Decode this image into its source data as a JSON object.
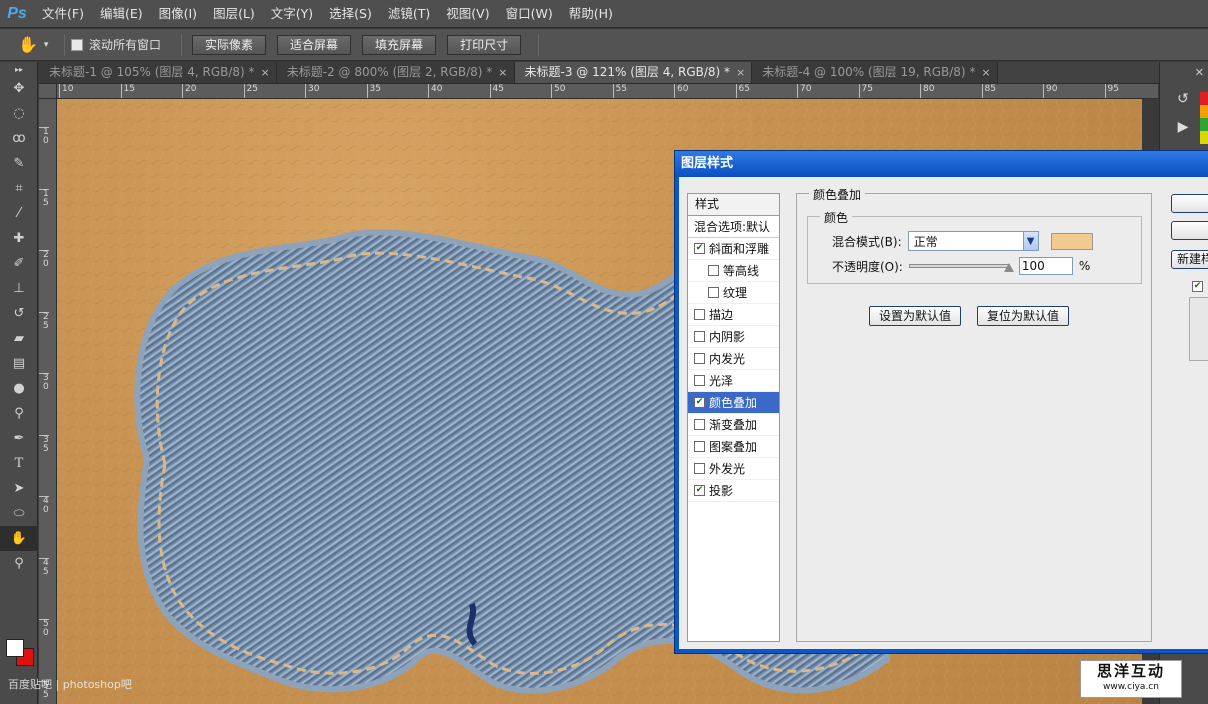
{
  "app": {
    "logo": "Ps"
  },
  "menu": [
    "文件(F)",
    "编辑(E)",
    "图像(I)",
    "图层(L)",
    "文字(Y)",
    "选择(S)",
    "滤镜(T)",
    "视图(V)",
    "窗口(W)",
    "帮助(H)"
  ],
  "options": {
    "scroll_all_label": "滚动所有窗口",
    "buttons": [
      "实际像素",
      "适合屏幕",
      "填充屏幕",
      "打印尺寸"
    ]
  },
  "tabs": [
    {
      "label": "未标题-1 @ 105% (图层 4, RGB/8) *",
      "active": false
    },
    {
      "label": "未标题-2 @ 800% (图层 2, RGB/8) *",
      "active": false
    },
    {
      "label": "未标题-3 @ 121% (图层 4, RGB/8) *",
      "active": true
    },
    {
      "label": "未标题-4 @ 100% (图层 19, RGB/8) *",
      "active": false
    }
  ],
  "ruler_h": [
    "10",
    "15",
    "20",
    "25",
    "30",
    "35",
    "40",
    "45",
    "50",
    "55",
    "60",
    "65",
    "70",
    "75",
    "80",
    "85",
    "90",
    "95"
  ],
  "ruler_v": [
    "10",
    "15",
    "20",
    "25",
    "30",
    "35",
    "40",
    "45",
    "50",
    "55"
  ],
  "dialog": {
    "title": "图层样式",
    "styles_header": "样式",
    "blend_options": "混合选项:默认",
    "items": [
      {
        "label": "斜面和浮雕",
        "checked": true,
        "sub": false,
        "selected": false
      },
      {
        "label": "等高线",
        "checked": false,
        "sub": true,
        "selected": false
      },
      {
        "label": "纹理",
        "checked": false,
        "sub": true,
        "selected": false
      },
      {
        "label": "描边",
        "checked": false,
        "sub": false,
        "selected": false
      },
      {
        "label": "内阴影",
        "checked": false,
        "sub": false,
        "selected": false
      },
      {
        "label": "内发光",
        "checked": false,
        "sub": false,
        "selected": false
      },
      {
        "label": "光泽",
        "checked": false,
        "sub": false,
        "selected": false
      },
      {
        "label": "颜色叠加",
        "checked": true,
        "sub": false,
        "selected": true
      },
      {
        "label": "渐变叠加",
        "checked": false,
        "sub": false,
        "selected": false
      },
      {
        "label": "图案叠加",
        "checked": false,
        "sub": false,
        "selected": false
      },
      {
        "label": "外发光",
        "checked": false,
        "sub": false,
        "selected": false
      },
      {
        "label": "投影",
        "checked": true,
        "sub": false,
        "selected": false
      }
    ],
    "section_title": "颜色叠加",
    "subsection_title": "颜色",
    "blend_mode_label": "混合模式(B):",
    "blend_mode_value": "正常",
    "overlay_color": "#f2c98e",
    "opacity_label": "不透明度(O):",
    "opacity_value": "100",
    "opacity_unit": "%",
    "set_default": "设置为默认值",
    "reset_default": "复位为默认值",
    "new_style_button": "新建样式...",
    "preview_checked": true
  },
  "watermark": {
    "left": "百度贴吧 | photoshop吧",
    "brand": "思洋互动",
    "url": "www.ciya.cn"
  }
}
